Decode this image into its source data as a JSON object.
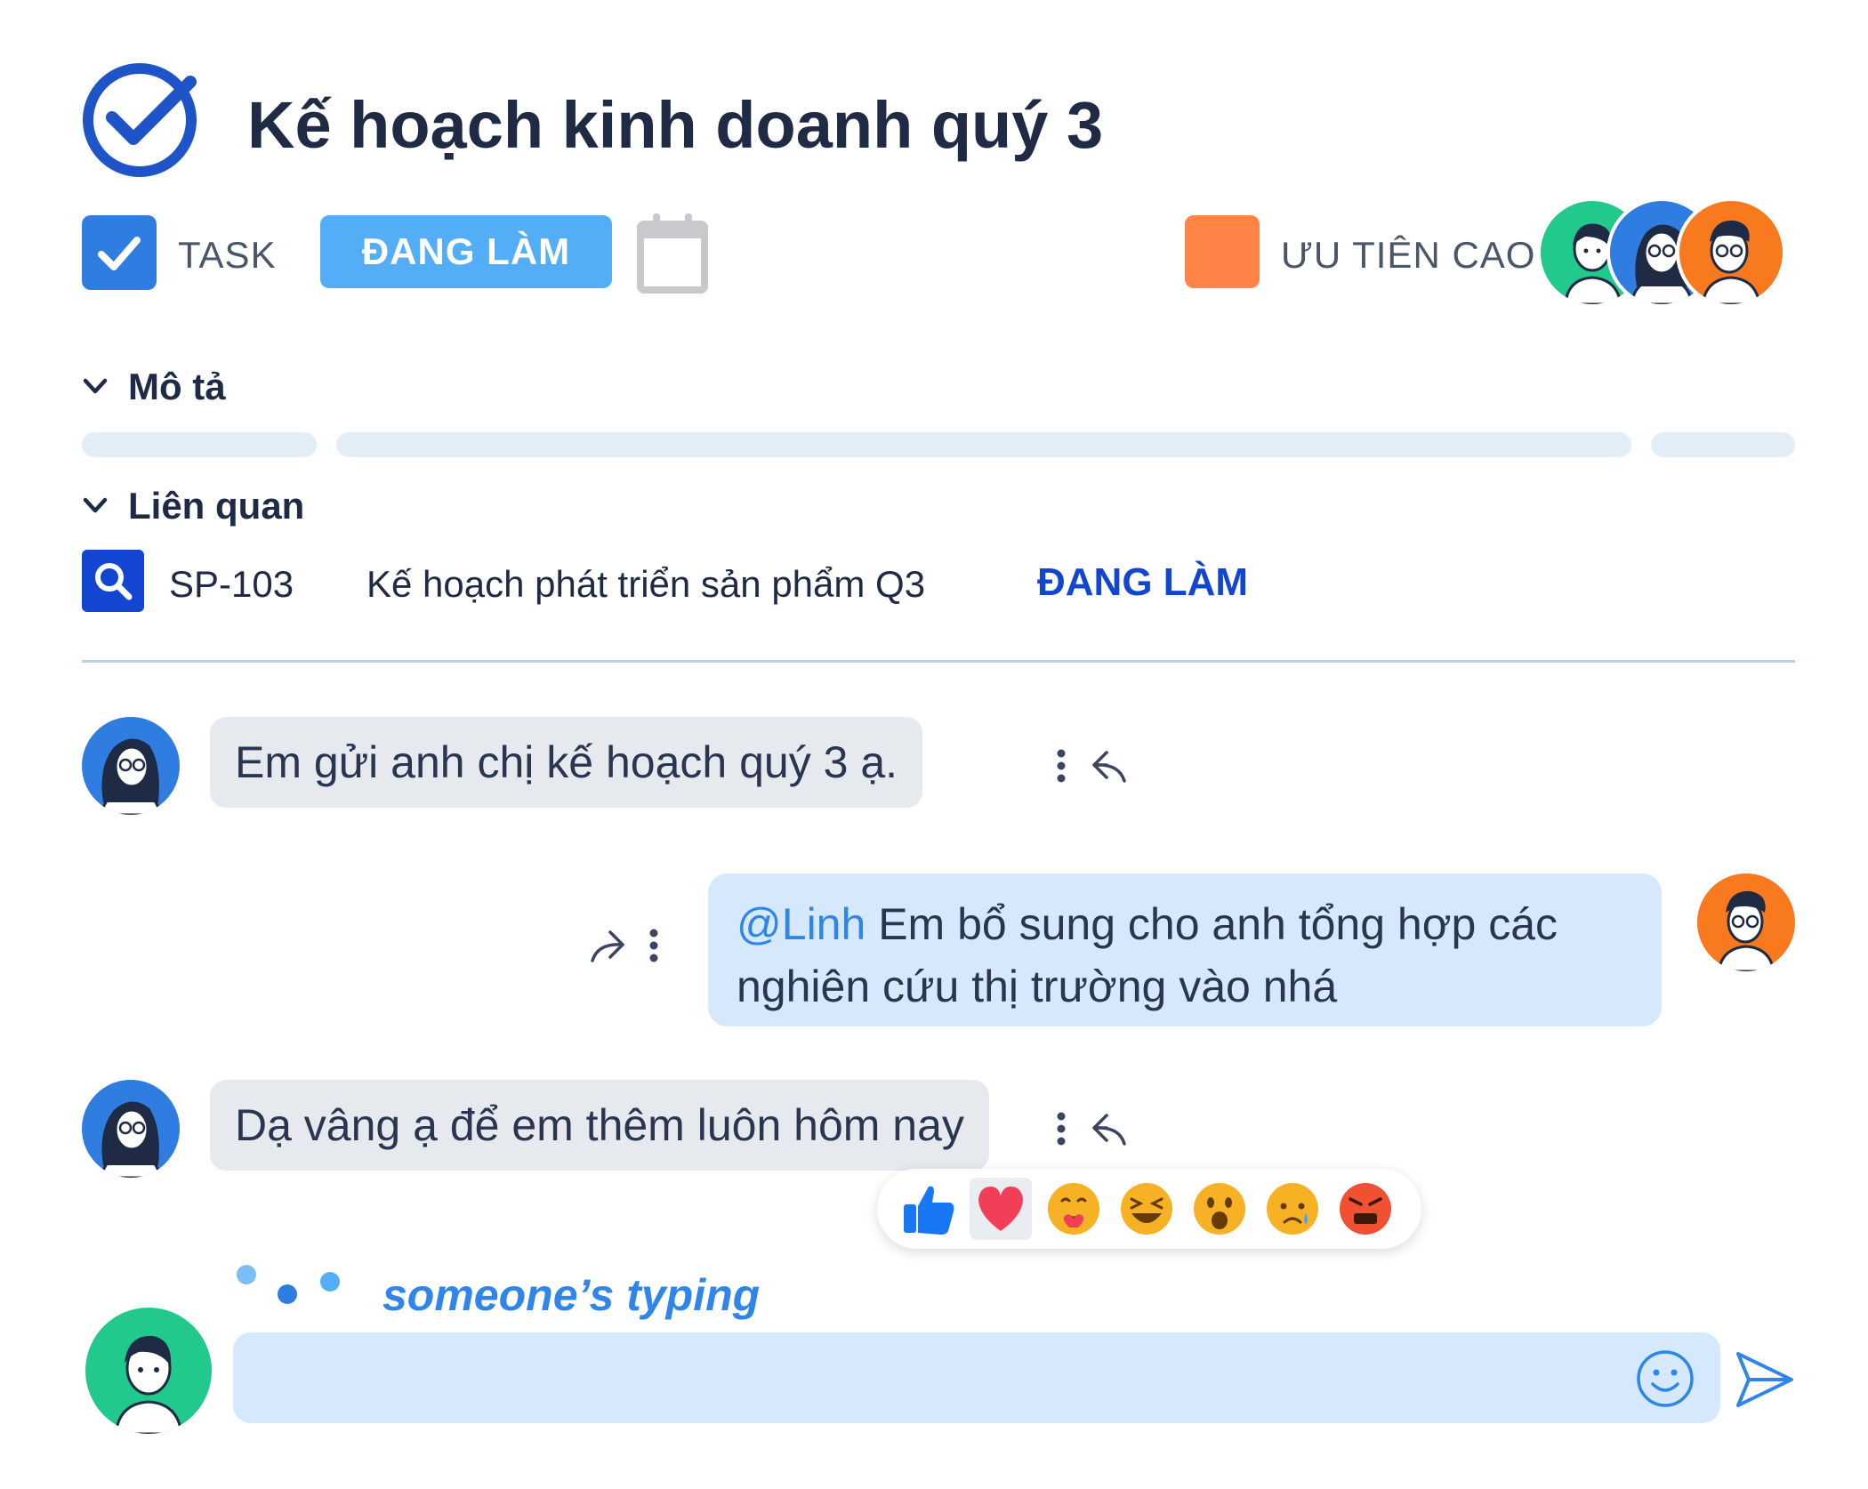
{
  "header": {
    "title": "Kế hoạch kinh doanh quý 3",
    "title_icon": "check-circle-icon",
    "issue_type_label": "TASK",
    "status_button": "ĐANG LÀM",
    "calendar_icon": "calendar-icon",
    "priority_label": "ƯU TIÊN CAO",
    "priority_color": "#ff8446",
    "watchers": [
      "green",
      "blue",
      "orange"
    ]
  },
  "sections": {
    "description_label": "Mô tả",
    "related_label": "Liên quan"
  },
  "related_issue": {
    "key": "SP-103",
    "title": "Kế hoạch phát triển sản phẩm Q3",
    "status": "ĐANG LÀM"
  },
  "messages": [
    {
      "from": "Linh",
      "direction": "in",
      "text": "Em gửi anh chị kế hoạch quý 3 ạ."
    },
    {
      "from": "me",
      "direction": "out",
      "mention": "@Linh",
      "text": " Em bổ sung cho anh tổng hợp các nghiên cứu thị trường vào nhá"
    },
    {
      "from": "Linh",
      "direction": "in",
      "text": "Dạ vâng ạ để em thêm luôn hôm nay"
    }
  ],
  "reactions": [
    "like",
    "love",
    "care",
    "haha",
    "wow",
    "sad",
    "angry"
  ],
  "selected_reaction": "love",
  "typing_indicator": "someone’s typing",
  "composer": {
    "value": "",
    "placeholder": ""
  },
  "colors": {
    "primary_blue": "#2f7de1",
    "status_blue": "#54aef7",
    "link_blue": "#1246d0",
    "bubble_in": "#e6e9ee",
    "bubble_out": "#d6e9fc"
  }
}
